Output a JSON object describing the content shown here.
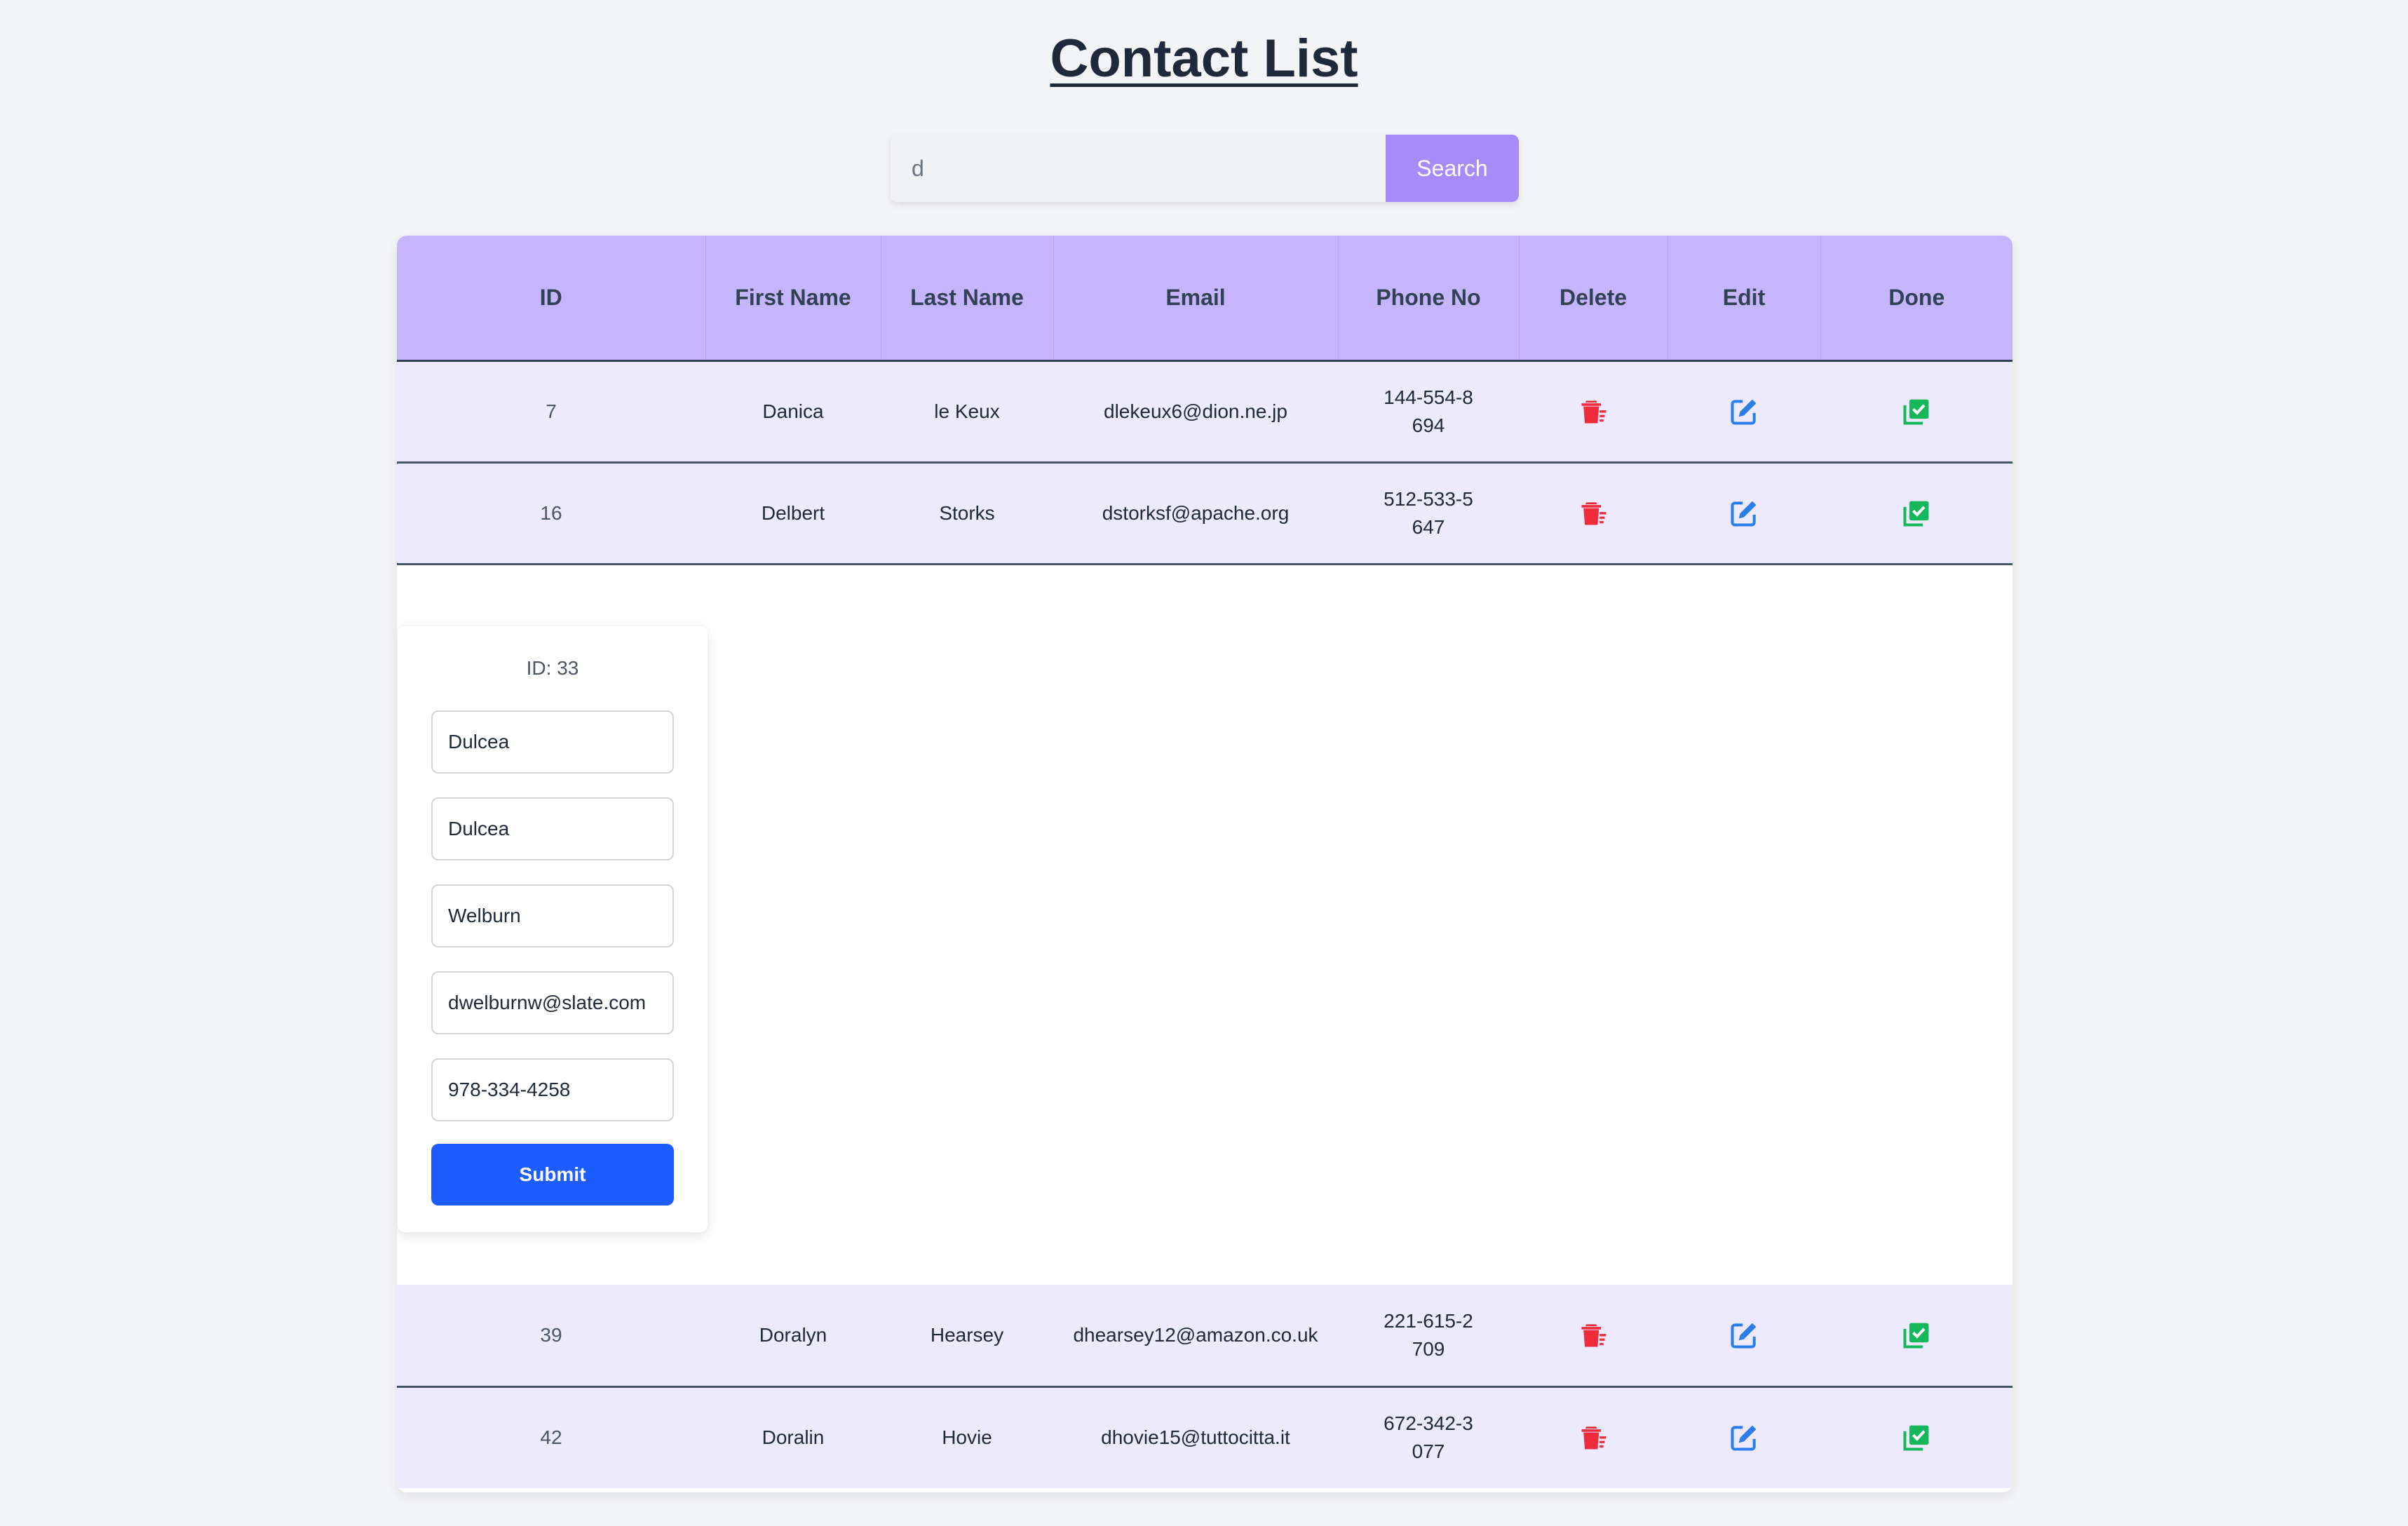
{
  "page": {
    "title": "Contact List"
  },
  "search": {
    "value": "d",
    "button_label": "Search"
  },
  "table": {
    "headers": {
      "id": "ID",
      "first_name": "First Name",
      "last_name": "Last Name",
      "email": "Email",
      "phone": "Phone No",
      "delete": "Delete",
      "edit": "Edit",
      "done": "Done"
    },
    "rows_top": [
      {
        "id": "7",
        "first": "Danica",
        "last": "le Keux",
        "email": "dlekeux6@dion.ne.jp",
        "phone": "144-554-8694"
      },
      {
        "id": "16",
        "first": "Delbert",
        "last": "Storks",
        "email": "dstorksf@apache.org",
        "phone": "512-533-5647"
      }
    ],
    "rows_bottom": [
      {
        "id": "39",
        "first": "Doralyn",
        "last": "Hearsey",
        "email": "dhearsey12@amazon.co.uk",
        "phone": "221-615-2709"
      },
      {
        "id": "42",
        "first": "Doralin",
        "last": "Hovie",
        "email": "dhovie15@tuttocitta.it",
        "phone": "672-342-3077"
      }
    ]
  },
  "edit_form": {
    "id_label": "ID: 33",
    "field1": "Dulcea",
    "field2": "Dulcea",
    "field3": "Welburn",
    "field4": "dwelburnw@slate.com",
    "field5": "978-334-4258",
    "submit_label": "Submit"
  },
  "icons": {
    "delete": "trash-icon",
    "edit": "edit-icon",
    "done": "check-square-icon",
    "delete_color": "#ef2b3c",
    "edit_color": "#2b7de9",
    "done_color": "#14b85a"
  },
  "colors": {
    "header_bg": "#c4b5fd",
    "row_bg": "#ede9fe",
    "search_btn": "#a78bfa",
    "submit_btn": "#1d5cff"
  }
}
